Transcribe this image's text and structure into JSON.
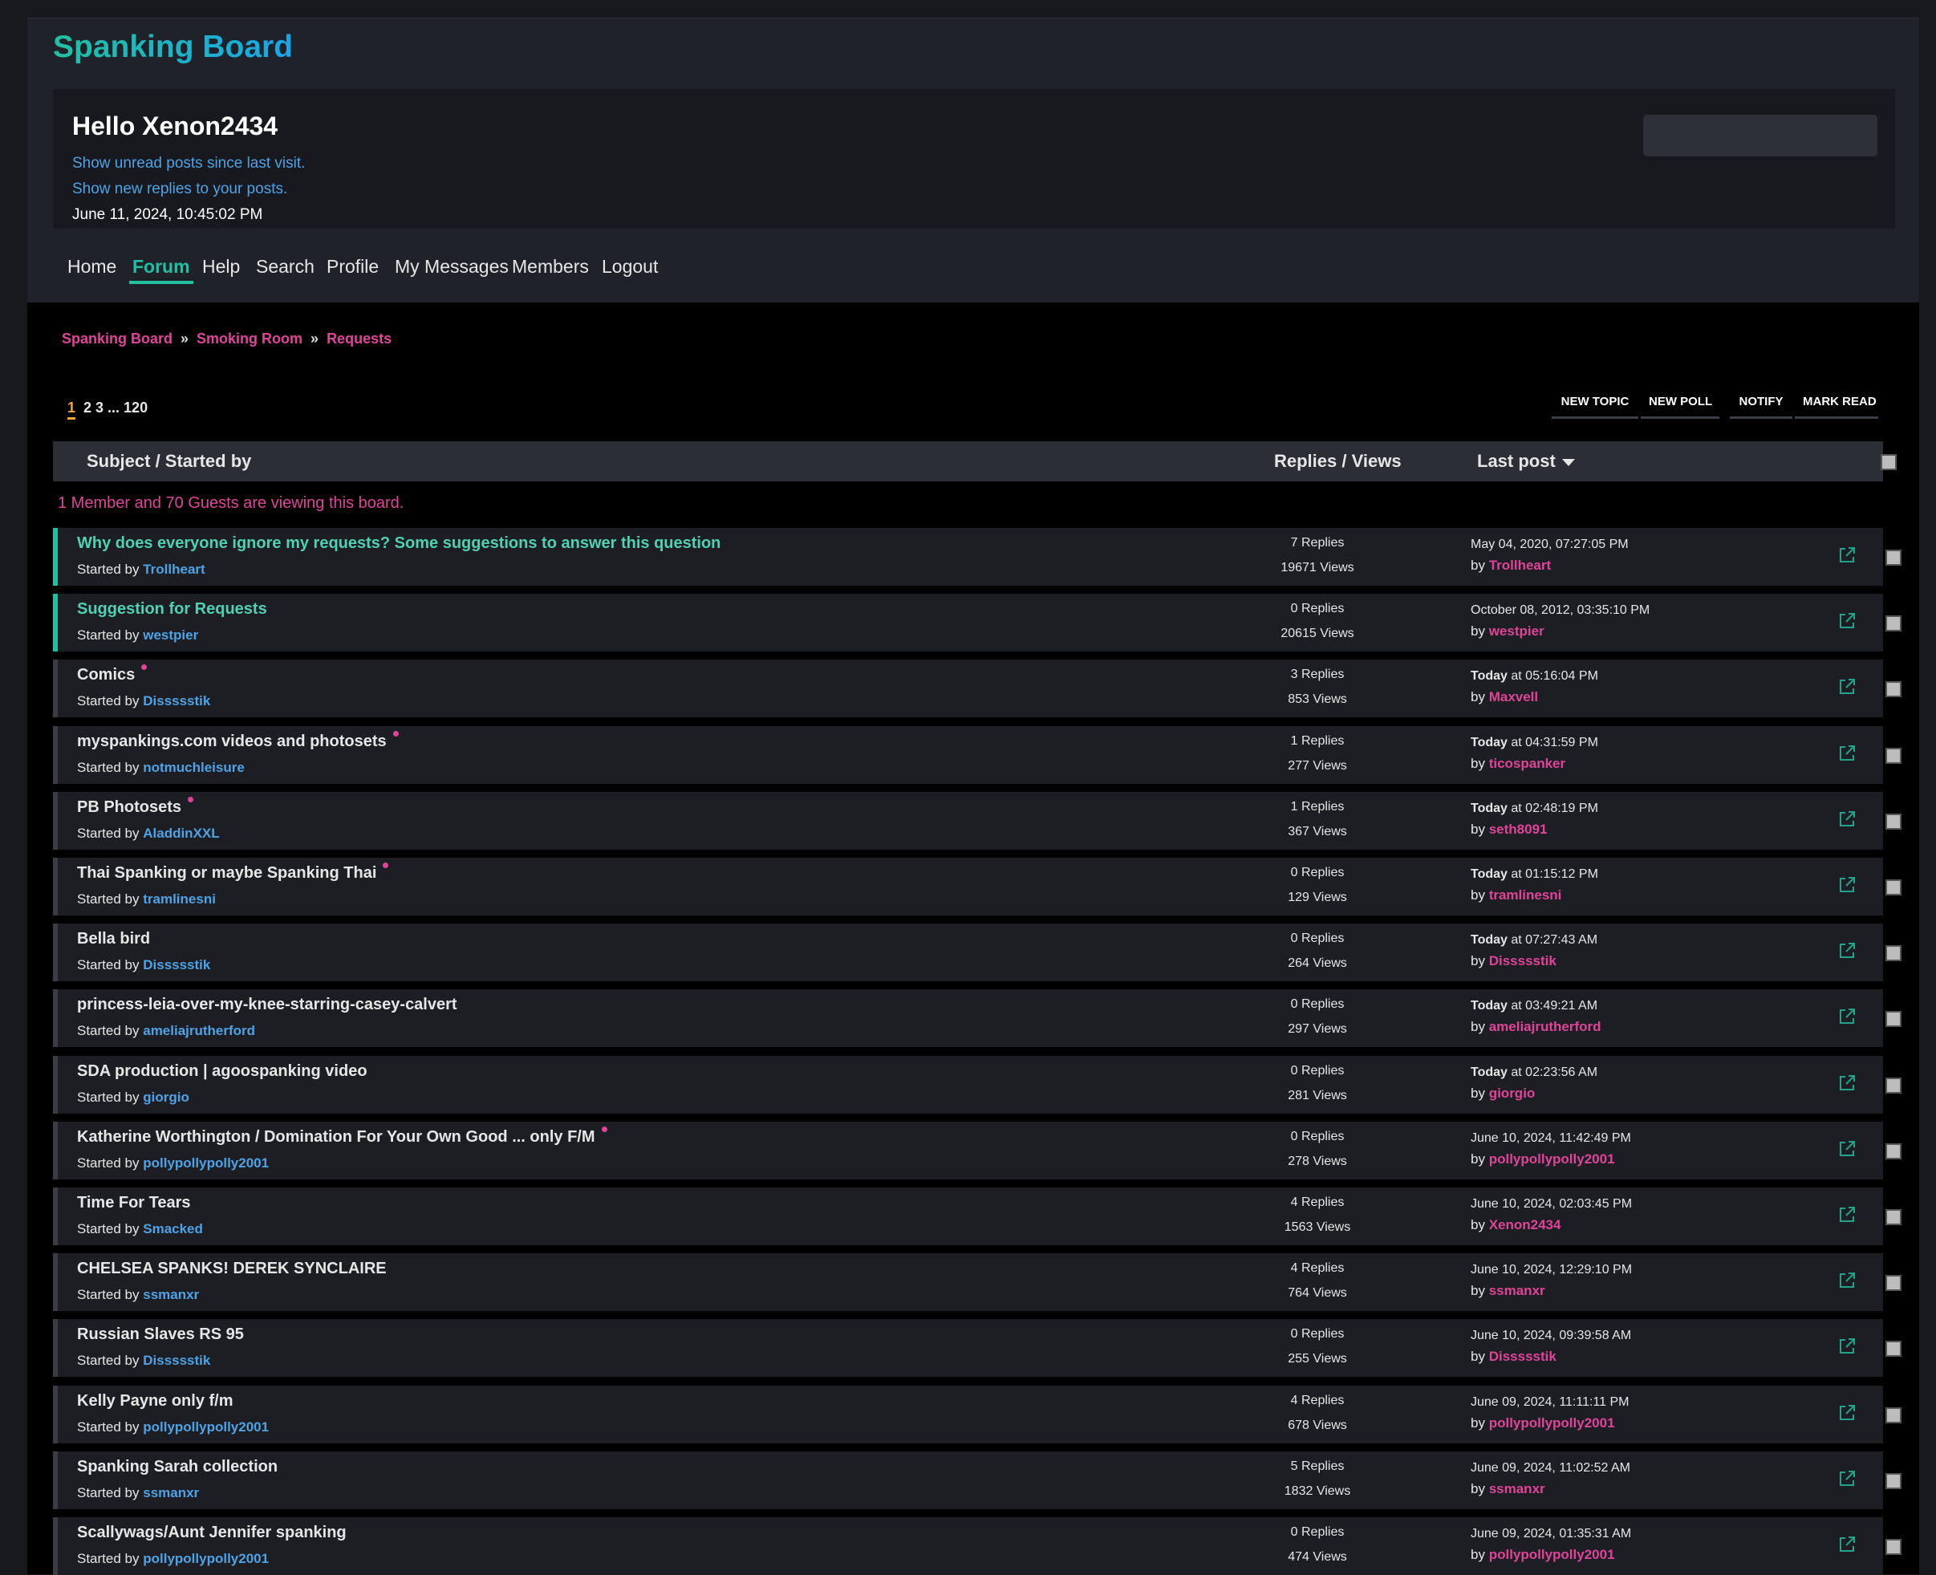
{
  "site": {
    "title": "Spanking Board"
  },
  "user": {
    "greeting": "Hello Xenon2434",
    "unread_link": "Show unread posts since last visit.",
    "replies_link": "Show new replies to your posts.",
    "datetime": "June 11, 2024, 10:45:02 PM",
    "search_value": ""
  },
  "nav": [
    "Home",
    "Forum",
    "Help",
    "Search",
    "Profile",
    "My Messages",
    "Members",
    "Logout"
  ],
  "nav_active": "Forum",
  "breadcrumb": [
    "Spanking Board",
    "Smoking Room",
    "Requests"
  ],
  "pagination": {
    "current": "1",
    "others": "2 3 ... 120"
  },
  "actions": [
    "New Topic",
    "New Poll",
    "Notify",
    "Mark Read"
  ],
  "table_header": {
    "subject": "Subject / Started by",
    "replies": "Replies / Views",
    "last": "Last post"
  },
  "viewing": "1 Member and 70 Guests are viewing this board.",
  "started_by_label": "Started by",
  "by_label": "by",
  "topics": [
    {
      "subject": "Why does everyone ignore my requests? Some suggestions to answer this question",
      "starter": "Trollheart",
      "replies": "7 Replies",
      "views": "19671 Views",
      "last_prefix": "",
      "last_time": "May 04, 2020, 07:27:05 PM",
      "last_by": "Trollheart",
      "sticky": true,
      "new": false
    },
    {
      "subject": "Suggestion for Requests",
      "starter": "westpier",
      "replies": "0 Replies",
      "views": "20615 Views",
      "last_prefix": "",
      "last_time": "October 08, 2012, 03:35:10 PM",
      "last_by": "westpier",
      "sticky": true,
      "new": false
    },
    {
      "subject": "Comics",
      "starter": "Dissssstik",
      "replies": "3 Replies",
      "views": "853 Views",
      "last_prefix": "Today",
      "last_time": " at 05:16:04 PM",
      "last_by": "Maxvell",
      "sticky": false,
      "new": true
    },
    {
      "subject": "myspankings.com videos and photosets",
      "starter": "notmuchleisure",
      "replies": "1 Replies",
      "views": "277 Views",
      "last_prefix": "Today",
      "last_time": " at 04:31:59 PM",
      "last_by": "ticospanker",
      "sticky": false,
      "new": true
    },
    {
      "subject": "PB Photosets",
      "starter": "AladdinXXL",
      "replies": "1 Replies",
      "views": "367 Views",
      "last_prefix": "Today",
      "last_time": " at 02:48:19 PM",
      "last_by": "seth8091",
      "sticky": false,
      "new": true
    },
    {
      "subject": "Thai Spanking or maybe Spanking Thai",
      "starter": "tramlinesni",
      "replies": "0 Replies",
      "views": "129 Views",
      "last_prefix": "Today",
      "last_time": " at 01:15:12 PM",
      "last_by": "tramlinesni",
      "sticky": false,
      "new": true
    },
    {
      "subject": "Bella bird",
      "starter": "Dissssstik",
      "replies": "0 Replies",
      "views": "264 Views",
      "last_prefix": "Today",
      "last_time": " at 07:27:43 AM",
      "last_by": "Dissssstik",
      "sticky": false,
      "new": false
    },
    {
      "subject": "princess-leia-over-my-knee-starring-casey-calvert",
      "starter": "ameliajrutherford",
      "replies": "0 Replies",
      "views": "297 Views",
      "last_prefix": "Today",
      "last_time": " at 03:49:21 AM",
      "last_by": "ameliajrutherford",
      "sticky": false,
      "new": false
    },
    {
      "subject": "SDA production | agoospanking video",
      "starter": "giorgio",
      "replies": "0 Replies",
      "views": "281 Views",
      "last_prefix": "Today",
      "last_time": " at 02:23:56 AM",
      "last_by": "giorgio",
      "sticky": false,
      "new": false
    },
    {
      "subject": "Katherine Worthington / Domination For Your Own Good ... only F/M",
      "starter": "pollypollypolly2001",
      "replies": "0 Replies",
      "views": "278 Views",
      "last_prefix": "",
      "last_time": "June 10, 2024, 11:42:49 PM",
      "last_by": "pollypollypolly2001",
      "sticky": false,
      "new": true
    },
    {
      "subject": "Time For Tears",
      "starter": "Smacked",
      "replies": "4 Replies",
      "views": "1563 Views",
      "last_prefix": "",
      "last_time": "June 10, 2024, 02:03:45 PM",
      "last_by": "Xenon2434",
      "sticky": false,
      "new": false
    },
    {
      "subject": "CHELSEA SPANKS! DEREK SYNCLAIRE",
      "starter": "ssmanxr",
      "replies": "4 Replies",
      "views": "764 Views",
      "last_prefix": "",
      "last_time": "June 10, 2024, 12:29:10 PM",
      "last_by": "ssmanxr",
      "sticky": false,
      "new": false
    },
    {
      "subject": "Russian Slaves RS 95",
      "starter": "Dissssstik",
      "replies": "0 Replies",
      "views": "255 Views",
      "last_prefix": "",
      "last_time": "June 10, 2024, 09:39:58 AM",
      "last_by": "Dissssstik",
      "sticky": false,
      "new": false
    },
    {
      "subject": "Kelly Payne only f/m",
      "starter": "pollypollypolly2001",
      "replies": "4 Replies",
      "views": "678 Views",
      "last_prefix": "",
      "last_time": "June 09, 2024, 11:11:11 PM",
      "last_by": "pollypollypolly2001",
      "sticky": false,
      "new": false
    },
    {
      "subject": "Spanking Sarah collection",
      "starter": "ssmanxr",
      "replies": "5 Replies",
      "views": "1832 Views",
      "last_prefix": "",
      "last_time": "June 09, 2024, 11:02:52 AM",
      "last_by": "ssmanxr",
      "sticky": false,
      "new": false
    },
    {
      "subject": "Scallywags/Aunt Jennifer spanking",
      "starter": "pollypollypolly2001",
      "replies": "0 Replies",
      "views": "474 Views",
      "last_prefix": "",
      "last_time": "June 09, 2024, 01:35:31 AM",
      "last_by": "pollypollypolly2001",
      "sticky": false,
      "new": false
    }
  ],
  "colors": {
    "accent": "#22c0a2",
    "link": "#4ea3e6",
    "pink": "#e0449a",
    "current_page": "#f2a53a"
  },
  "icons": {
    "external": "external-link-icon",
    "caret": "caret-down-icon"
  }
}
